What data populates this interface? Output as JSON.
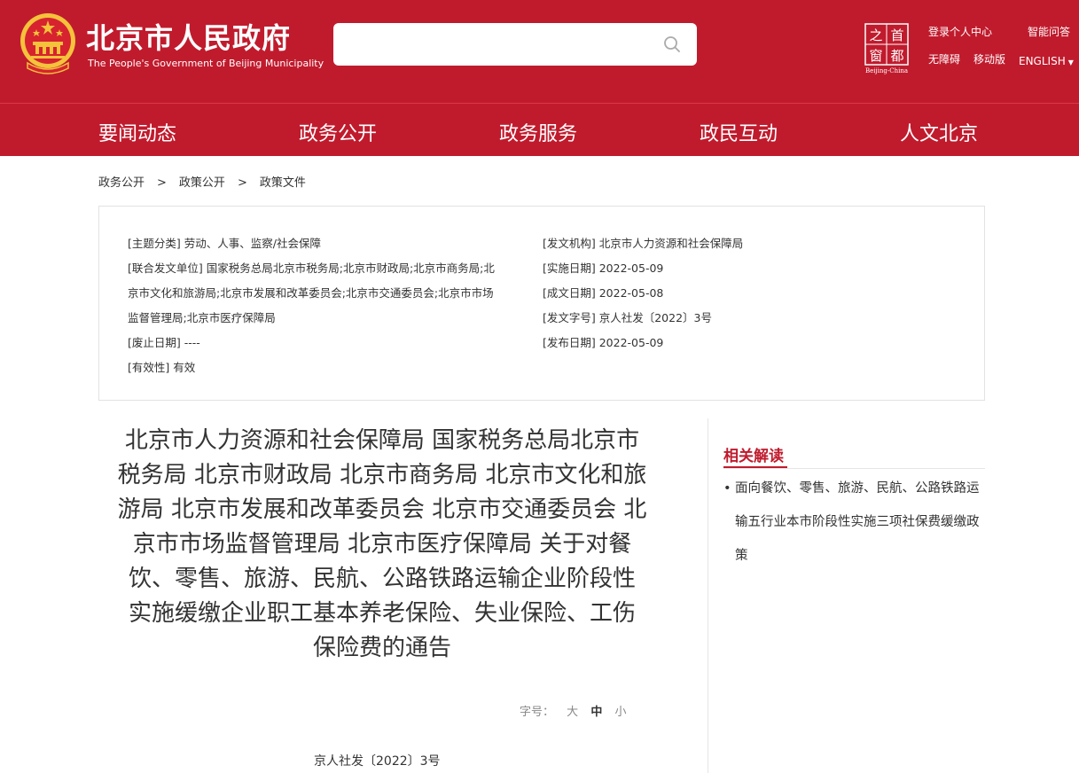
{
  "header": {
    "title_cn": "北京市人民政府",
    "title_en": "The People's Government of Beijing Municipality",
    "search": {
      "placeholder": "",
      "value": ""
    },
    "capital_logo": {
      "chars": [
        "首",
        "都",
        "之",
        "窗"
      ],
      "caption": "Beijing-China"
    },
    "links": {
      "login": "登录个人中心",
      "ai_qa": "智能问答",
      "accessibility": "无障碍",
      "mobile": "移动版",
      "english": "ENGLISH"
    },
    "colors": {
      "brand": "#c01b2d",
      "gold": "#f4c23b"
    }
  },
  "nav": {
    "items": [
      "要闻动态",
      "政务公开",
      "政务服务",
      "政民互动",
      "人文北京"
    ]
  },
  "breadcrumb": {
    "items": [
      "政务公开",
      "政策公开",
      "政策文件"
    ],
    "separator": ">"
  },
  "meta": {
    "left": [
      "[主题分类] 劳动、人事、监察/社会保障",
      "[联合发文单位] 国家税务总局北京市税务局;北京市财政局;北京市商务局;北",
      "京市文化和旅游局;北京市发展和改革委员会;北京市交通委员会;北京市市场",
      "监督管理局;北京市医疗保障局",
      "[废止日期] ----",
      "[有效性] 有效"
    ],
    "right": [
      "[发文机构] 北京市人力资源和社会保障局",
      "[实施日期] 2022-05-09",
      "[成文日期] 2022-05-08",
      "[发文字号] 京人社发〔2022〕3号",
      "[发布日期] 2022-05-09"
    ]
  },
  "document": {
    "title_lines": [
      "北京市人力资源和社会保障局 国家税务总局北京市",
      "税务局 北京市财政局 北京市商务局 北京市文化和旅",
      "游局 北京市发展和改革委员会 北京市交通委员会 北",
      "京市市场监督管理局 北京市医疗保障局 关于对餐",
      "饮、零售、旅游、民航、公路铁路运输企业阶段性",
      "实施缓缴企业职工基本养老保险、失业保险、工伤",
      "保险费的通告"
    ],
    "font_size": {
      "label": "字号：",
      "large": "大",
      "medium": "中",
      "small": "小",
      "active": "medium"
    },
    "number": "京人社发〔2022〕3号"
  },
  "sidebar": {
    "related_title": "相关解读",
    "bullet": "•",
    "items": [
      "面向餐饮、零售、旅游、民航、公路铁路运输五行业本市阶段性实施三项社保费缓缴政策"
    ]
  }
}
